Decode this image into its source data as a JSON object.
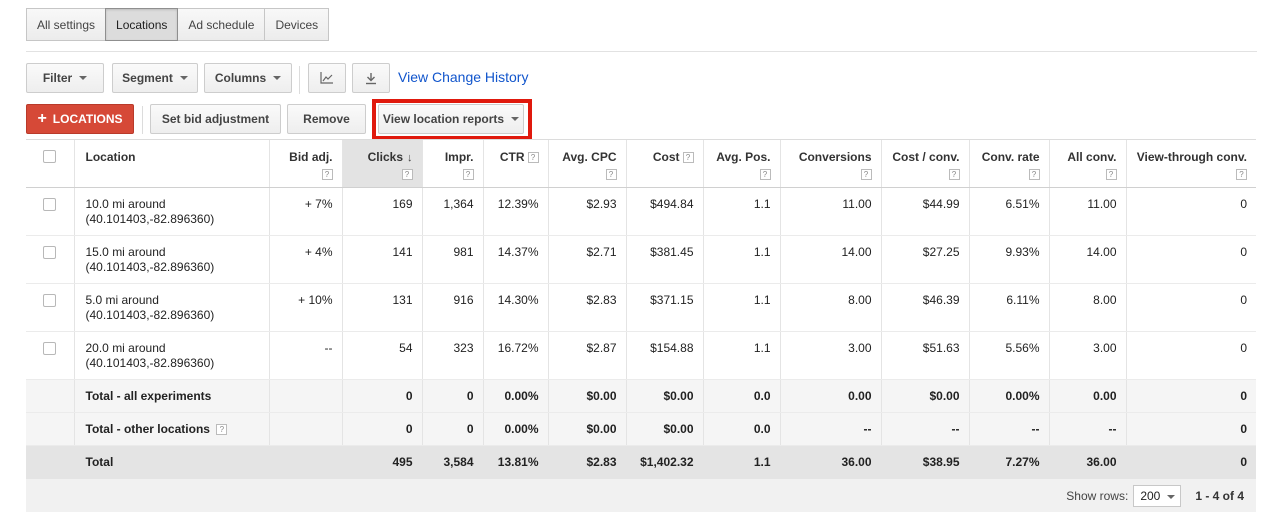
{
  "tabs": [
    {
      "label": "All settings",
      "active": false
    },
    {
      "label": "Locations",
      "active": true
    },
    {
      "label": "Ad schedule",
      "active": false
    },
    {
      "label": "Devices",
      "active": false
    }
  ],
  "toolbar": {
    "filter_label": "Filter",
    "segment_label": "Segment",
    "columns_label": "Columns",
    "chart_icon": "line-chart-icon",
    "download_icon": "download-icon",
    "view_change_history": "View Change History"
  },
  "actions": {
    "add_locations_label": "LOCATIONS",
    "set_bid_adjustment_label": "Set bid adjustment",
    "remove_label": "Remove",
    "view_location_reports_label": "View location reports"
  },
  "table": {
    "columns": {
      "location": "Location",
      "bid_adj": "Bid adj.",
      "clicks": "Clicks",
      "impr": "Impr.",
      "ctr": "CTR",
      "avg_cpc": "Avg. CPC",
      "cost": "Cost",
      "avg_pos": "Avg. Pos.",
      "conversions": "Conversions",
      "cost_conv": "Cost / conv.",
      "conv_rate": "Conv. rate",
      "all_conv": "All conv.",
      "view_through": "View-through conv."
    },
    "help_glyph": "?",
    "rows": [
      {
        "location": "10.0 mi around (40.101403,-82.896360)",
        "bid_adj": "+ 7%",
        "clicks": "169",
        "impr": "1,364",
        "ctr": "12.39%",
        "avg_cpc": "$2.93",
        "cost": "$494.84",
        "avg_pos": "1.1",
        "conversions": "11.00",
        "cost_conv": "$44.99",
        "conv_rate": "6.51%",
        "all_conv": "11.00",
        "view_through": "0"
      },
      {
        "location": "15.0 mi around (40.101403,-82.896360)",
        "bid_adj": "+ 4%",
        "clicks": "141",
        "impr": "981",
        "ctr": "14.37%",
        "avg_cpc": "$2.71",
        "cost": "$381.45",
        "avg_pos": "1.1",
        "conversions": "14.00",
        "cost_conv": "$27.25",
        "conv_rate": "9.93%",
        "all_conv": "14.00",
        "view_through": "0"
      },
      {
        "location": "5.0 mi around (40.101403,-82.896360)",
        "bid_adj": "+ 10%",
        "clicks": "131",
        "impr": "916",
        "ctr": "14.30%",
        "avg_cpc": "$2.83",
        "cost": "$371.15",
        "avg_pos": "1.1",
        "conversions": "8.00",
        "cost_conv": "$46.39",
        "conv_rate": "6.11%",
        "all_conv": "8.00",
        "view_through": "0"
      },
      {
        "location": "20.0 mi around (40.101403,-82.896360)",
        "bid_adj": "--",
        "clicks": "54",
        "impr": "323",
        "ctr": "16.72%",
        "avg_cpc": "$2.87",
        "cost": "$154.88",
        "avg_pos": "1.1",
        "conversions": "3.00",
        "cost_conv": "$51.63",
        "conv_rate": "5.56%",
        "all_conv": "3.00",
        "view_through": "0"
      }
    ],
    "totals": [
      {
        "location": "Total - all experiments",
        "help": false,
        "bid_adj": "",
        "clicks": "0",
        "impr": "0",
        "ctr": "0.00%",
        "avg_cpc": "$0.00",
        "cost": "$0.00",
        "avg_pos": "0.0",
        "conversions": "0.00",
        "cost_conv": "$0.00",
        "conv_rate": "0.00%",
        "all_conv": "0.00",
        "view_through": "0"
      },
      {
        "location": "Total - other locations",
        "help": true,
        "bid_adj": "",
        "clicks": "0",
        "impr": "0",
        "ctr": "0.00%",
        "avg_cpc": "$0.00",
        "cost": "$0.00",
        "avg_pos": "0.0",
        "conversions": "--",
        "cost_conv": "--",
        "conv_rate": "--",
        "all_conv": "--",
        "view_through": "0"
      }
    ],
    "grand_total": {
      "location": "Total",
      "bid_adj": "",
      "clicks": "495",
      "impr": "3,584",
      "ctr": "13.81%",
      "avg_cpc": "$2.83",
      "cost": "$1,402.32",
      "avg_pos": "1.1",
      "conversions": "36.00",
      "cost_conv": "$38.95",
      "conv_rate": "7.27%",
      "all_conv": "36.00",
      "view_through": "0"
    }
  },
  "footer": {
    "show_rows_label": "Show rows:",
    "rows_value": "200",
    "pagination": "1 - 4 of 4"
  },
  "colors": {
    "accent_red": "#d64937",
    "highlight_box": "#e0190d",
    "link_blue": "#1155cc"
  }
}
